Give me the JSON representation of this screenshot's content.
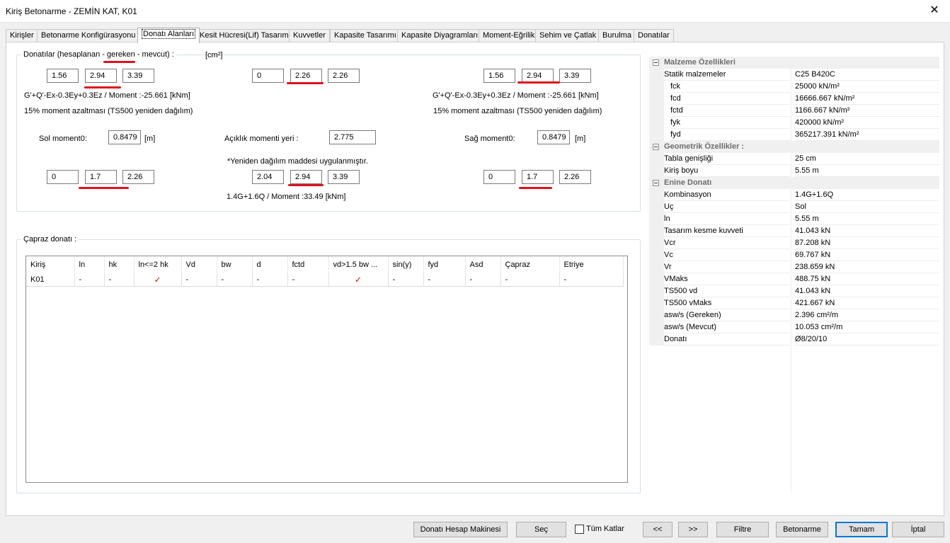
{
  "window": {
    "title": "Kiriş Betonarme - ZEMİN KAT, K01",
    "close_glyph": "✕"
  },
  "tabs": [
    "Kirişler",
    "Betonarme Konfigürasyonu",
    "Donatı Alanları",
    "Kesit Hücresi(Lif) Tasarımı",
    "Kuvvetler",
    "Kapasite Tasarımı",
    "Kapasite Diyagramları",
    "Moment-Eğrilik",
    "Sehim ve Çatlak",
    "Burulma",
    "Donatılar"
  ],
  "donati": {
    "legend_pre": "Donatılar (hesaplanan - ",
    "legend_mid": "gereken",
    "legend_post": " - mevcut) :",
    "unit": "[cm²]",
    "top_left": [
      "1.56",
      "2.94",
      "3.39"
    ],
    "top_mid": [
      "0",
      "2.26",
      "2.26"
    ],
    "top_right": [
      "1.56",
      "2.94",
      "3.39"
    ],
    "combo_left": "G'+Q'-Ex-0.3Ey+0.3Ez  / Moment :-25.661 [kNm]",
    "combo_right": "G'+Q'-Ex-0.3Ey+0.3Ez  / Moment :-25.661 [kNm]",
    "reduction_left": "15% moment azaltması (TS500 yeniden dağılım)",
    "reduction_right": "15% moment azaltması (TS500 yeniden dağılım)",
    "sol_label": "Sol moment0:",
    "sol_value": "0.8479",
    "sol_unit": "[m]",
    "aciklik_label": "Açıklık momenti yeri :",
    "aciklik_value": "2.775",
    "sag_label": "Sağ moment0:",
    "sag_value": "0.8479",
    "sag_unit": "[m]",
    "redistribution_note": "*Yeniden dağılım maddesi uygulanmıştır.",
    "bot_left": [
      "0",
      "1.7",
      "2.26"
    ],
    "bot_mid": [
      "2.04",
      "2.94",
      "3.39"
    ],
    "bot_right": [
      "0",
      "1.7",
      "2.26"
    ],
    "combo_mid": "1.4G+1.6Q  / Moment :33.49 [kNm]"
  },
  "capraz": {
    "legend": "Çapraz donatı :",
    "columns": [
      "Kiriş",
      "ln",
      "hk",
      "ln<=2 hk",
      "Vd",
      "bw",
      "d",
      "fctd",
      "vd>1.5 bw ...",
      "sin(y)",
      "fyd",
      "Asd",
      "Çapraz",
      "Etriye"
    ],
    "row": [
      "K01",
      "-",
      "-",
      "✓",
      "-",
      "-",
      "-",
      "-",
      "✓",
      "-",
      "-",
      "-",
      "-",
      "-"
    ]
  },
  "properties": {
    "malzeme": {
      "title": "Malzeme Özellikleri",
      "rows": [
        [
          "Statik malzemeler",
          "C25 B420C"
        ],
        [
          "fck",
          "25000 kN/m²"
        ],
        [
          "fcd",
          "16666.667 kN/m²"
        ],
        [
          "fctd",
          "1166.667 kN/m²"
        ],
        [
          "fyk",
          "420000 kN/m²"
        ],
        [
          "fyd",
          "365217.391 kN/m²"
        ]
      ]
    },
    "geometrik": {
      "title": "Geometrik Özellikler :",
      "rows": [
        [
          "Tabla genişliği",
          "25 cm"
        ],
        [
          "Kiriş boyu",
          "5.55 m"
        ]
      ]
    },
    "enine": {
      "title": "Enine Donatı",
      "rows": [
        [
          "Kombinasyon",
          "1.4G+1.6Q"
        ],
        [
          "Uç",
          "Sol"
        ],
        [
          "ln",
          "5.55 m"
        ],
        [
          "Tasarım kesme kuvveti",
          "41.043 kN"
        ],
        [
          "Vcr",
          "87.208 kN"
        ],
        [
          "Vc",
          "69.767 kN"
        ],
        [
          "Vr",
          "238.659 kN"
        ],
        [
          "VMaks",
          "488.75 kN"
        ],
        [
          "TS500 vd",
          "41.043 kN"
        ],
        [
          "TS500 vMaks",
          "421.667 kN"
        ],
        [
          "asw/s (Gereken)",
          "2.396 cm²/m"
        ],
        [
          "asw/s (Mevcut)",
          "10.053 cm²/m"
        ],
        [
          "Donatı",
          "Ø8/20/10"
        ]
      ]
    }
  },
  "footer": {
    "calc": "Donatı Hesap Makinesi",
    "sec": "Seç",
    "tum_katlar": "Tüm Katlar",
    "prev": "<<",
    "next": ">>",
    "filtre": "Filtre",
    "betonarme": "Betonarme",
    "tamam": "Tamam",
    "iptal": "İptal"
  },
  "colors": {
    "accent": "#0078d7",
    "highlight": "#e0121c"
  }
}
